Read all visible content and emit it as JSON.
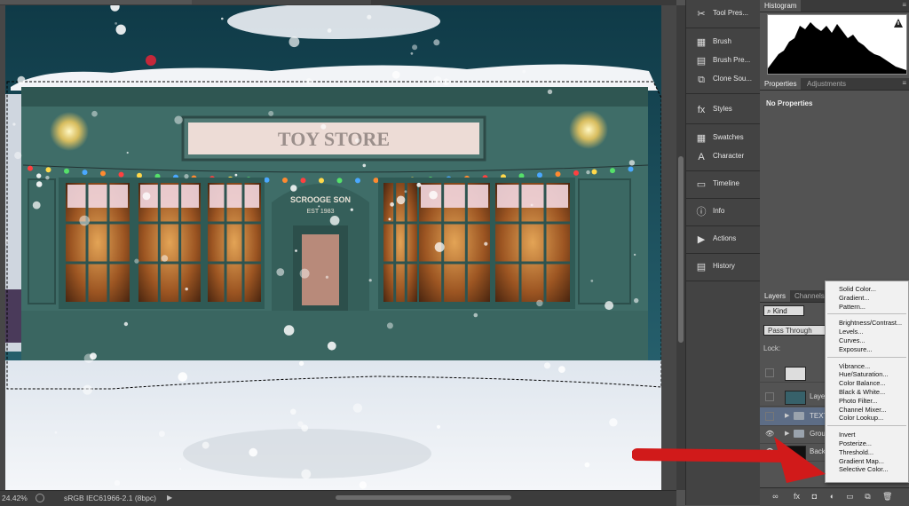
{
  "document": {
    "tab1_title": "",
    "tab2_title": "",
    "zoom": "24.42%",
    "color_profile": "sRGB IEC61966-2.1 (8bpc)",
    "sign_text": "TOY STORE",
    "door_sign": "SCROOGE SON",
    "door_sign_est": "EST 1983"
  },
  "dock": {
    "groups": [
      [
        {
          "label": "Tool Pres...",
          "icon": "tool-presets-icon"
        }
      ],
      [
        {
          "label": "Brush",
          "icon": "brush-icon"
        },
        {
          "label": "Brush Pre...",
          "icon": "brush-presets-icon"
        },
        {
          "label": "Clone Sou...",
          "icon": "clone-source-icon"
        }
      ],
      [
        {
          "label": "Styles",
          "icon": "styles-icon"
        }
      ],
      [
        {
          "label": "Swatches",
          "icon": "swatches-icon"
        },
        {
          "label": "Character",
          "icon": "character-icon"
        }
      ],
      [
        {
          "label": "Timeline",
          "icon": "timeline-icon"
        }
      ],
      [
        {
          "label": "Info",
          "icon": "info-icon"
        }
      ],
      [
        {
          "label": "Actions",
          "icon": "actions-icon"
        }
      ],
      [
        {
          "label": "History",
          "icon": "history-icon"
        }
      ]
    ]
  },
  "histogram": {
    "title": "Histogram"
  },
  "properties": {
    "tab_properties": "Properties",
    "tab_adjustments": "Adjustments",
    "empty_label": "No Properties"
  },
  "layers": {
    "tab_layers": "Layers",
    "tab_channels": "Channels",
    "kind_label": "Kind",
    "blend_mode": "Pass Through",
    "lock_label": "Lock:",
    "rows": [
      {
        "name": "",
        "kind": "adjustment"
      },
      {
        "name": "Laye",
        "kind": "image"
      },
      {
        "name": "TEXT",
        "kind": "group"
      },
      {
        "name": "Grou",
        "kind": "group"
      },
      {
        "name": "Back",
        "kind": "background"
      }
    ]
  },
  "adjustment_menu": {
    "sections": [
      [
        "Solid Color...",
        "Gradient...",
        "Pattern..."
      ],
      [
        "Brightness/Contrast...",
        "Levels...",
        "Curves...",
        "Exposure..."
      ],
      [
        "Vibrance...",
        "Hue/Saturation...",
        "Color Balance...",
        "Black & White...",
        "Photo Filter...",
        "Channel Mixer...",
        "Color Lookup..."
      ],
      [
        "Invert",
        "Posterize...",
        "Threshold...",
        "Gradient Map...",
        "Selective Color..."
      ]
    ]
  },
  "colors": {
    "panel_bg": "#535353",
    "dock_bg": "#434343",
    "menu_bg": "#f1f1f1",
    "annotation_arrow": "#d11a1a",
    "storefront": "#3e6b66"
  }
}
